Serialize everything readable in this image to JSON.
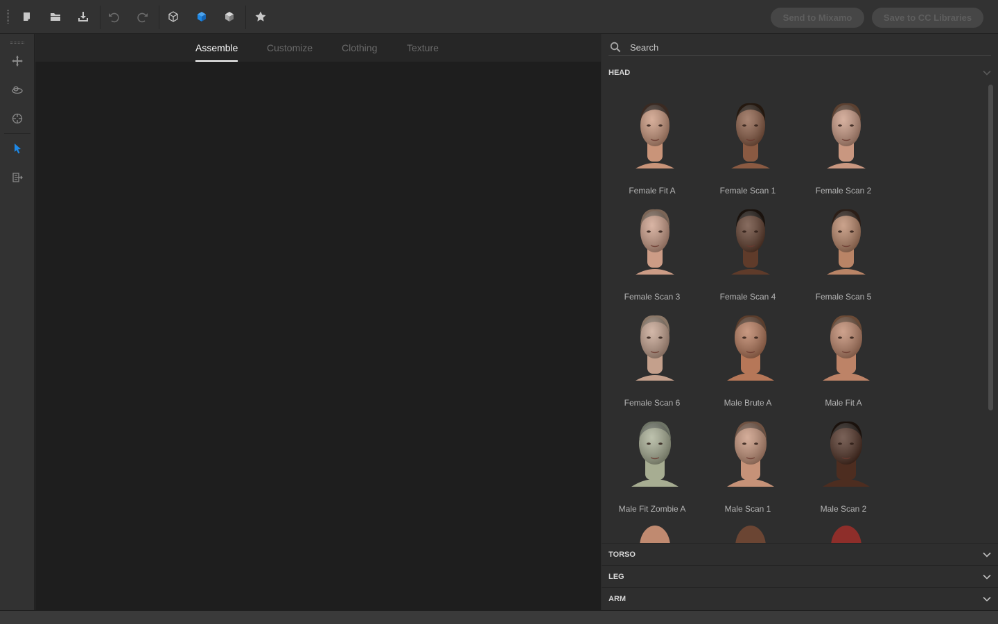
{
  "toolbar": {
    "buttons": [
      {
        "icon": "new-file-icon"
      },
      {
        "icon": "open-folder-icon"
      },
      {
        "icon": "download-icon"
      },
      {
        "icon": "undo-icon"
      },
      {
        "icon": "redo-icon"
      },
      {
        "icon": "cube-outline-icon"
      },
      {
        "icon": "cube-blue-icon"
      },
      {
        "icon": "cube-shaded-icon"
      },
      {
        "icon": "star-icon"
      }
    ],
    "send_label": "Send to Mixamo",
    "save_label": "Save to CC Libraries"
  },
  "rail": {
    "buttons": [
      {
        "icon": "move-icon"
      },
      {
        "icon": "orbit-icon"
      },
      {
        "icon": "target-icon"
      },
      {
        "icon": "select-cursor-icon"
      },
      {
        "icon": "export-icon"
      }
    ]
  },
  "tabs": [
    {
      "label": "Assemble",
      "active": true
    },
    {
      "label": "Customize",
      "active": false
    },
    {
      "label": "Clothing",
      "active": false
    },
    {
      "label": "Texture",
      "active": false
    }
  ],
  "search": {
    "placeholder": "Search"
  },
  "sections": {
    "head": "HEAD",
    "torso": "TORSO",
    "leg": "LEG",
    "arm": "ARM"
  },
  "heads": [
    {
      "name": "Female Fit A",
      "skin": "#c99479",
      "hair": "#3a2a22",
      "gender": "female"
    },
    {
      "name": "Female Scan 1",
      "skin": "#8a5a42",
      "hair": "#24180f",
      "gender": "female"
    },
    {
      "name": "Female Scan 2",
      "skin": "#c99780",
      "hair": "#5b4030",
      "gender": "female"
    },
    {
      "name": "Female Scan 3",
      "skin": "#cc9c86",
      "hair": "#7b6556",
      "gender": "female"
    },
    {
      "name": "Female Scan 4",
      "skin": "#5f3b2a",
      "hair": "#1a120d",
      "gender": "female"
    },
    {
      "name": "Female Scan 5",
      "skin": "#b98466",
      "hair": "#2b1e17",
      "gender": "female"
    },
    {
      "name": "Female Scan 6",
      "skin": "#c4a08c",
      "hair": "#8a7767",
      "gender": "female"
    },
    {
      "name": "Male Brute A",
      "skin": "#b67758",
      "hair": "#5a3d2c",
      "gender": "male"
    },
    {
      "name": "Male Fit A",
      "skin": "#bd8367",
      "hair": "#6a4a36",
      "gender": "male"
    },
    {
      "name": "Male Fit Zombie A",
      "skin": "#a7ad92",
      "hair": "#6e7466",
      "gender": "male"
    },
    {
      "name": "Male Scan 1",
      "skin": "#c69278",
      "hair": "#6f5242",
      "gender": "male"
    },
    {
      "name": "Male Scan 2",
      "skin": "#4d2d20",
      "hair": "#1a110c",
      "gender": "male"
    }
  ],
  "partial_heads": [
    {
      "skin": "#c08a70"
    },
    {
      "skin": "#6b4533"
    },
    {
      "skin": "#8e2e2a"
    }
  ],
  "colors": {
    "accent": "#1e88e5",
    "panel": "#2e2e2e",
    "viewport": "#1e1e1e"
  }
}
